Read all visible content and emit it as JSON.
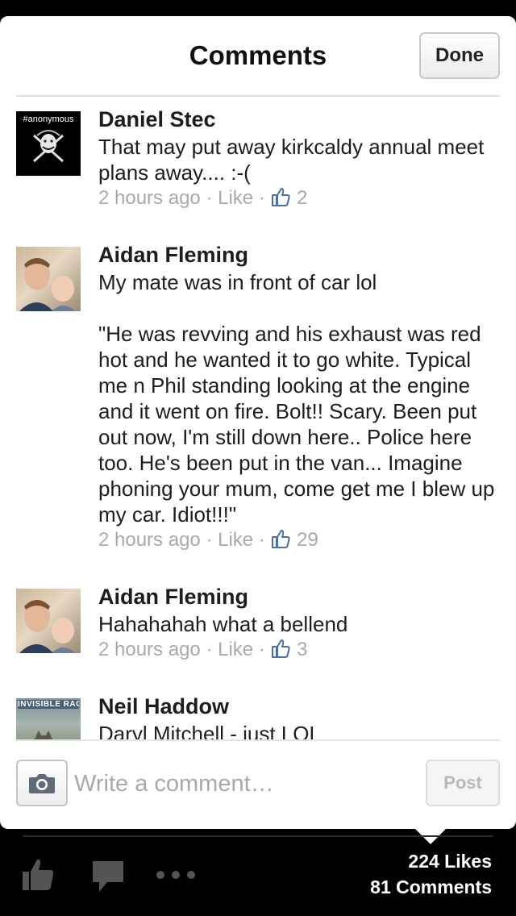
{
  "header": {
    "title": "Comments",
    "done_label": "Done"
  },
  "comments": [
    {
      "author": "Daniel Stec",
      "avatar_tag": "#anonymous",
      "text": "That may put away kirkcaldy annual meet plans away.... :-(",
      "time": "2 hours ago",
      "separator": "·",
      "like_label": "Like",
      "like_count": "2"
    },
    {
      "author": "Aidan Fleming",
      "text": "My mate was in front of car lol\n\n\"He was revving and his exhaust was red hot and he wanted it to go white. Typical me n Phil standing looking at the engine and it went on fire. Bolt!! Scary. Been put out now, I'm still down here.. Police here too. He's been put in the van... Imagine phoning your mum, come get me I blew up my car. Idiot!!!\"",
      "time": "2 hours ago",
      "separator": "·",
      "like_label": "Like",
      "like_count": "29"
    },
    {
      "author": "Aidan Fleming",
      "text": "Hahahahah what a bellend",
      "time": "2 hours ago",
      "separator": "·",
      "like_label": "Like",
      "like_count": "3"
    },
    {
      "author": "Neil Haddow",
      "avatar_tag": "INVISIBLE RACE CAR",
      "text": "Daryl Mitchell - just LOL"
    }
  ],
  "composer": {
    "placeholder": "Write a comment…",
    "post_label": "Post"
  },
  "footer": {
    "likes": "224 Likes",
    "comments": "81 Comments"
  },
  "colors": {
    "accent": "#4a6fa5",
    "meta_gray": "#a9a9a9",
    "text": "#1d1d1d"
  }
}
